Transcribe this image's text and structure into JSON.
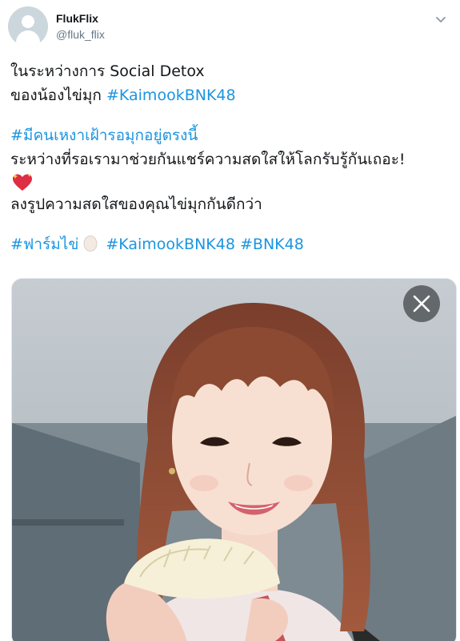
{
  "user": {
    "display_name": "FlukFlix",
    "handle": "@fluk_flix"
  },
  "tweet": {
    "line1": "ในระหว่างการ Social Detox",
    "line2_text": "ของน้องไข่มุก ",
    "line2_tag": "#KaimookBNK48",
    "line3_tag": "#มีคนเหงาเฝ้ารอมุกอยู่ตรงนี้",
    "line4": "ระหว่างที่รอเรามาช่วยกันแชร์ความสดใสให้โลกรับรู้กันเถอะ!",
    "line5": "ลงรูปความสดใสของคุณไข่มุกกันดีกว่า",
    "tag_farm": "#ฟาร์มไข่",
    "tag_kaimook": "#KaimookBNK48",
    "tag_bnk": "#BNK48"
  },
  "icons": {
    "caret": "chevron-down-icon",
    "heart": "sparkling-heart-emoji",
    "egg": "egg-emoji",
    "close": "close-icon"
  },
  "colors": {
    "link": "#1b95e0",
    "text": "#14171a",
    "secondary": "#657786"
  }
}
